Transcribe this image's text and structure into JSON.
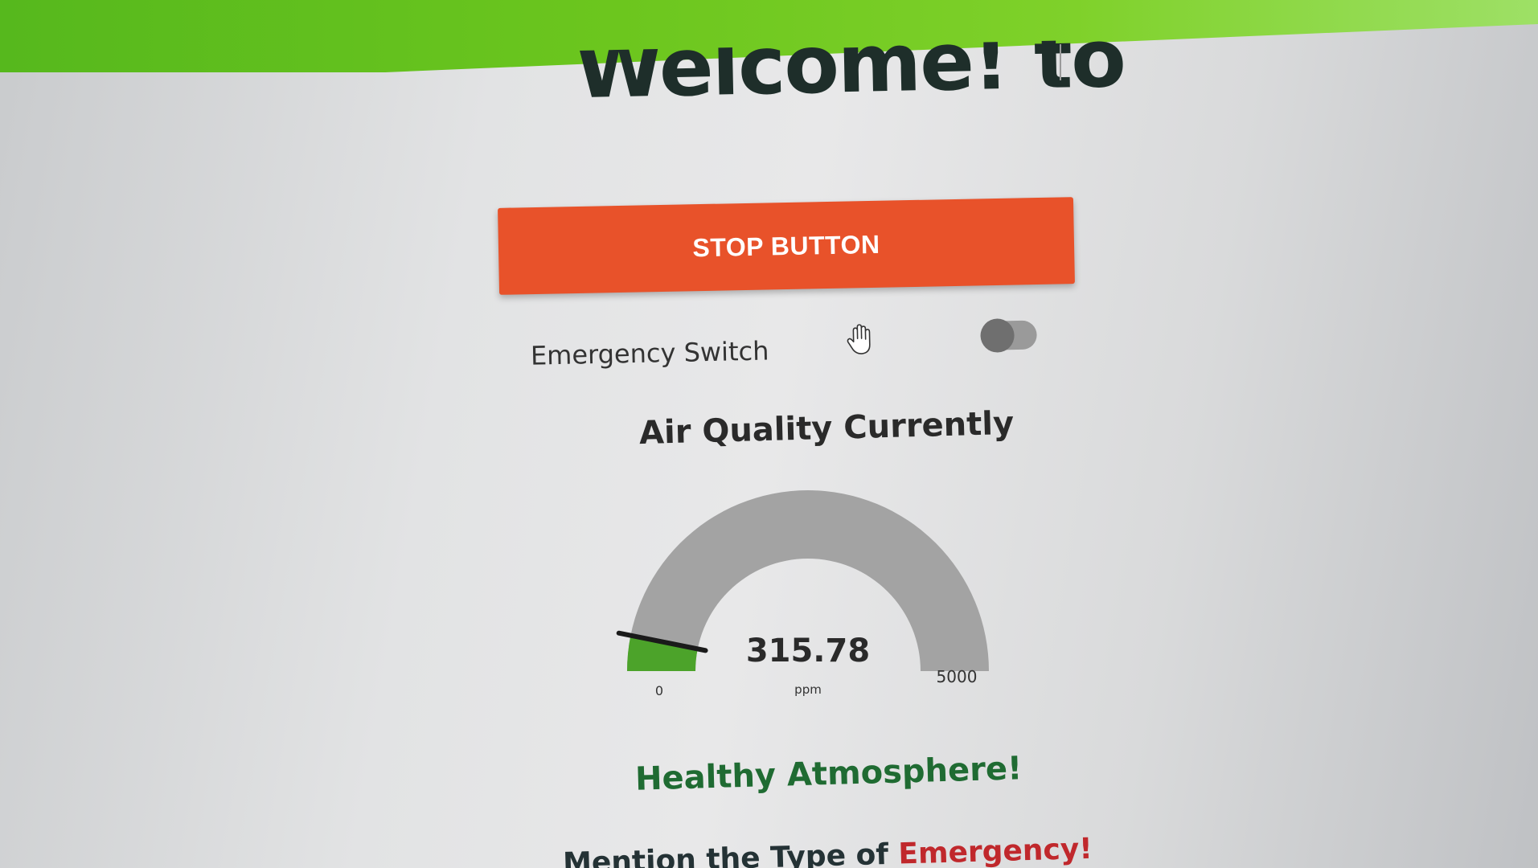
{
  "header": {
    "welcome_text": "Welcome! to",
    "accent_color": "#6cc61e"
  },
  "controls": {
    "stop_button_label": "STOP BUTTON",
    "stop_button_color": "#e8522a",
    "emergency_switch_label": "Emergency Switch",
    "emergency_switch_on": false
  },
  "air_quality": {
    "title": "Air Quality Currently",
    "value": "315.78",
    "value_numeric": 315.78,
    "unit": "ppm",
    "min_label": "0",
    "max_label": "5000",
    "min": 0,
    "max": 5000,
    "fill_color": "#4ca32a",
    "status_text": "Healthy Atmosphere!",
    "status_color": "#1f6b32"
  },
  "footer": {
    "mention_prefix": "Mention the Type of ",
    "mention_emphasis": "Emergency!"
  }
}
